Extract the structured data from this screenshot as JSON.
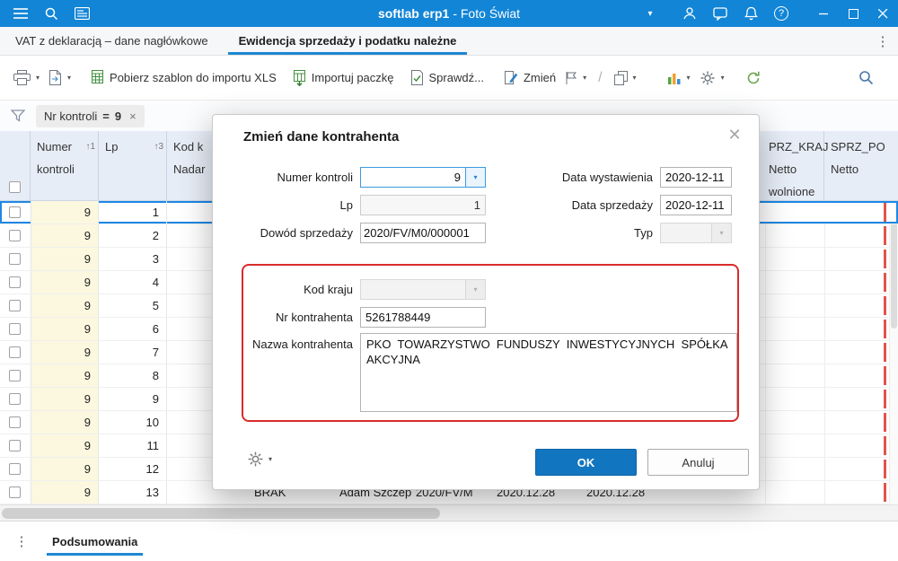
{
  "icons": {
    "chevron_down": "▾",
    "kebab": "⋮",
    "close": "✕",
    "times": "×",
    "slash": "/",
    "question": "?"
  },
  "colors": {
    "titlebar_blue": "#1285d6",
    "accent_blue": "#1e88d2",
    "ok_button": "#1275c0",
    "highlight_red": "#d92b2b",
    "cell_yellow": "#fbf8df"
  },
  "titlebar": {
    "app": "softlab erp1",
    "context": "- Foto Świat"
  },
  "tabs": {
    "tab1": "VAT z deklaracją – dane nagłówkowe",
    "tab2": "Ewidencja sprzedaży i podatku należne"
  },
  "toolbar": {
    "btn_template": "Pobierz szablon do importu XLS",
    "btn_import": "Importuj paczkę",
    "btn_check": "Sprawdź...",
    "btn_change": "Zmień"
  },
  "filterbar": {
    "field": "Nr kontroli",
    "op": "=",
    "value": "9"
  },
  "table": {
    "headers": {
      "col1_line1": "Numer",
      "col1_line2": "kontroli",
      "col1_sort": "↑1",
      "col2": "Lp",
      "col2_sort": "↑3",
      "col3_line1": "Kod k",
      "col3_line2": "Nadar",
      "prz_line1": "PRZ_KRAJ",
      "prz_line2": "Netto",
      "prz_line3": "wolnione",
      "sprz_line1": "SPRZ_PO",
      "sprz_line2": "Netto"
    },
    "rows": [
      {
        "kontrola": "9",
        "lp": "1",
        "selected": true
      },
      {
        "kontrola": "9",
        "lp": "2"
      },
      {
        "kontrola": "9",
        "lp": "3"
      },
      {
        "kontrola": "9",
        "lp": "4"
      },
      {
        "kontrola": "9",
        "lp": "5"
      },
      {
        "kontrola": "9",
        "lp": "6"
      },
      {
        "kontrola": "9",
        "lp": "7"
      },
      {
        "kontrola": "9",
        "lp": "8"
      },
      {
        "kontrola": "9",
        "lp": "9"
      },
      {
        "kontrola": "9",
        "lp": "10"
      },
      {
        "kontrola": "9",
        "lp": "11"
      },
      {
        "kontrola": "9",
        "lp": "12"
      },
      {
        "kontrola": "9",
        "lp": "13",
        "extras": [
          "BRAK",
          "Adam Szczep",
          "2020/FV/M",
          "2020.12.28",
          "2020.12.28"
        ]
      }
    ]
  },
  "dialog": {
    "title": "Zmień dane kontrahenta",
    "labels": {
      "numer_kontroli": "Numer kontroli",
      "lp": "Lp",
      "dowod": "Dowód sprzedaży",
      "data_wystawienia": "Data wystawienia",
      "data_sprzedazy": "Data sprzedaży",
      "typ": "Typ",
      "kod_kraju": "Kod kraju",
      "nr_kontrahenta": "Nr kontrahenta",
      "nazwa_kontrahenta": "Nazwa kontrahenta"
    },
    "values": {
      "numer_kontroli": "9",
      "lp": "1",
      "dowod": "2020/FV/M0/000001",
      "data_wystawienia": "2020-12-11",
      "data_sprzedazy": "2020-12-11",
      "typ": "",
      "kod_kraju": "",
      "nr_kontrahenta": "5261788449",
      "nazwa_kontrahenta": "PKO  TOWARZYSTWO  FUNDUSZY  INWESTYCYJNYCH  SPÓŁKA  AKCYJNA"
    },
    "buttons": {
      "ok": "OK",
      "cancel": "Anuluj"
    }
  },
  "footer": {
    "tab": "Podsumowania"
  }
}
